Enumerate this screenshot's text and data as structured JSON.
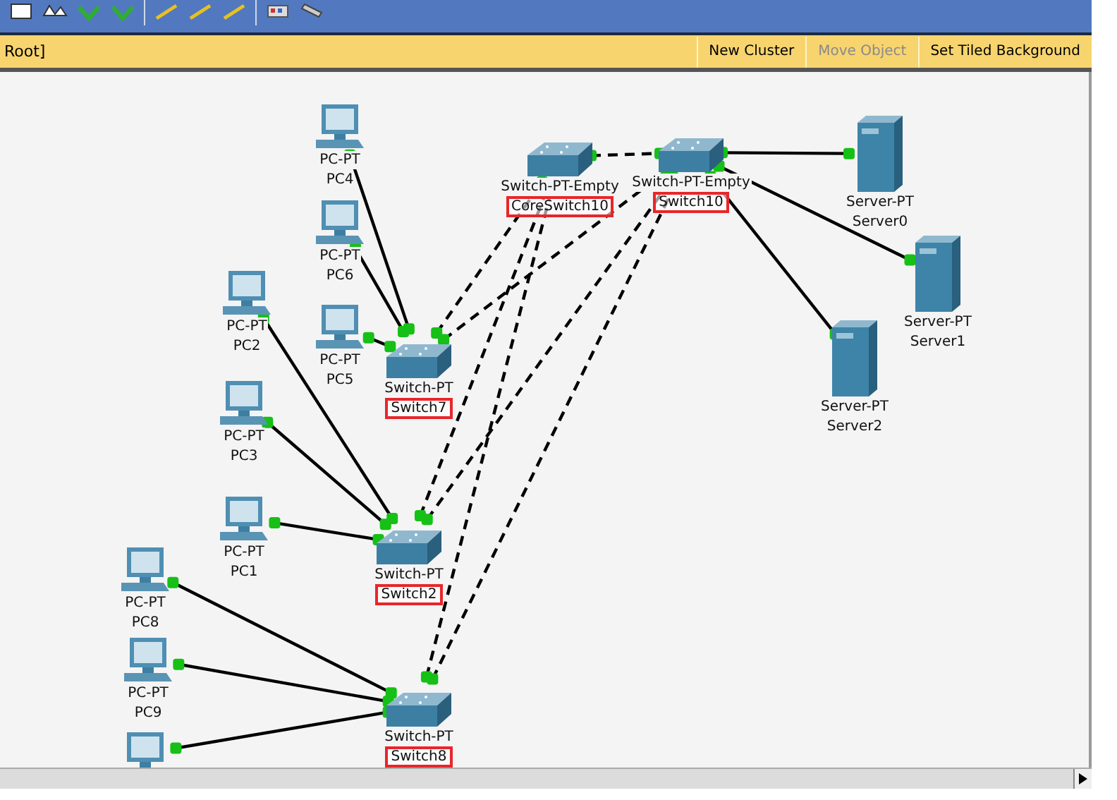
{
  "breadcrumb": "Root]",
  "actions": [
    {
      "label": "New Cluster",
      "disabled": false
    },
    {
      "label": "Move Object",
      "disabled": true
    },
    {
      "label": "Set Tiled Background",
      "disabled": false
    }
  ],
  "nodes": [
    {
      "kind": "switch",
      "type": "Switch-PT-Empty",
      "name": "CoreSwitch10",
      "highlighted": true
    },
    {
      "kind": "switch",
      "type": "Switch-PT-Empty",
      "name": "Switch10",
      "highlighted": true
    },
    {
      "kind": "server",
      "type": "Server-PT",
      "name": "Server0",
      "highlighted": false
    },
    {
      "kind": "server",
      "type": "Server-PT",
      "name": "Server1",
      "highlighted": false
    },
    {
      "kind": "server",
      "type": "Server-PT",
      "name": "Server2",
      "highlighted": false
    },
    {
      "kind": "pc",
      "type": "PC-PT",
      "name": "PC4",
      "highlighted": false
    },
    {
      "kind": "pc",
      "type": "PC-PT",
      "name": "PC6",
      "highlighted": false
    },
    {
      "kind": "pc",
      "type": "PC-PT",
      "name": "PC5",
      "highlighted": false
    },
    {
      "kind": "switch",
      "type": "Switch-PT",
      "name": "Switch7",
      "highlighted": true
    },
    {
      "kind": "pc",
      "type": "PC-PT",
      "name": "PC2",
      "highlighted": false
    },
    {
      "kind": "pc",
      "type": "PC-PT",
      "name": "PC3",
      "highlighted": false
    },
    {
      "kind": "pc",
      "type": "PC-PT",
      "name": "PC1",
      "highlighted": false
    },
    {
      "kind": "switch",
      "type": "Switch-PT",
      "name": "Switch2",
      "highlighted": true
    },
    {
      "kind": "pc",
      "type": "PC-PT",
      "name": "PC8",
      "highlighted": false
    },
    {
      "kind": "pc",
      "type": "PC-PT",
      "name": "PC9",
      "highlighted": false
    },
    {
      "kind": "pc"
    },
    {
      "kind": "switch",
      "type": "Switch-PT",
      "name": "Switch8",
      "highlighted": true
    }
  ],
  "links": [
    {
      "kind": "straight"
    },
    {
      "kind": "straight"
    },
    {
      "kind": "straight"
    },
    {
      "kind": "straight"
    },
    {
      "kind": "straight"
    },
    {
      "kind": "straight"
    },
    {
      "kind": "straight"
    },
    {
      "kind": "straight"
    },
    {
      "kind": "straight"
    },
    {
      "kind": "straight"
    },
    {
      "kind": "straight"
    },
    {
      "kind": "straight"
    },
    {
      "kind": "crossover"
    },
    {
      "kind": "crossover"
    },
    {
      "kind": "crossover"
    },
    {
      "kind": "crossover"
    },
    {
      "kind": "crossover"
    },
    {
      "kind": "crossover"
    },
    {
      "kind": "crossover"
    }
  ]
}
